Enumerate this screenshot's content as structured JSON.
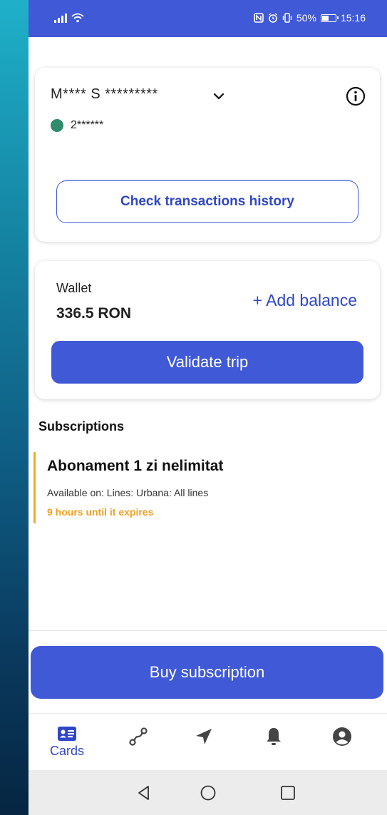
{
  "status_bar": {
    "battery_text": "50%",
    "time": "15:16",
    "battery_level": 0.5
  },
  "account": {
    "name": "M**** S *********",
    "number": "2******",
    "history_button": "Check transactions history"
  },
  "wallet": {
    "label": "Wallet",
    "balance": "336.5 RON",
    "add_balance": "+ Add balance",
    "validate_button": "Validate trip"
  },
  "subscriptions": {
    "heading": "Subscriptions",
    "items": [
      {
        "title": "Abonament 1 zi nelimitat",
        "lines": "Available on: Lines: Urbana: All lines",
        "expiry": "9 hours until it expires"
      }
    ]
  },
  "buy_button": "Buy subscription",
  "tabs": [
    {
      "icon": "cards-icon",
      "label": "Cards",
      "active": true
    },
    {
      "icon": "route-icon"
    },
    {
      "icon": "location-arrow-icon"
    },
    {
      "icon": "bell-icon"
    },
    {
      "icon": "user-icon"
    }
  ],
  "colors": {
    "primary": "#4059d6",
    "accent_text": "#2f47c8",
    "status_green": "#2e8b6b",
    "expiry_orange": "#f0a020"
  }
}
